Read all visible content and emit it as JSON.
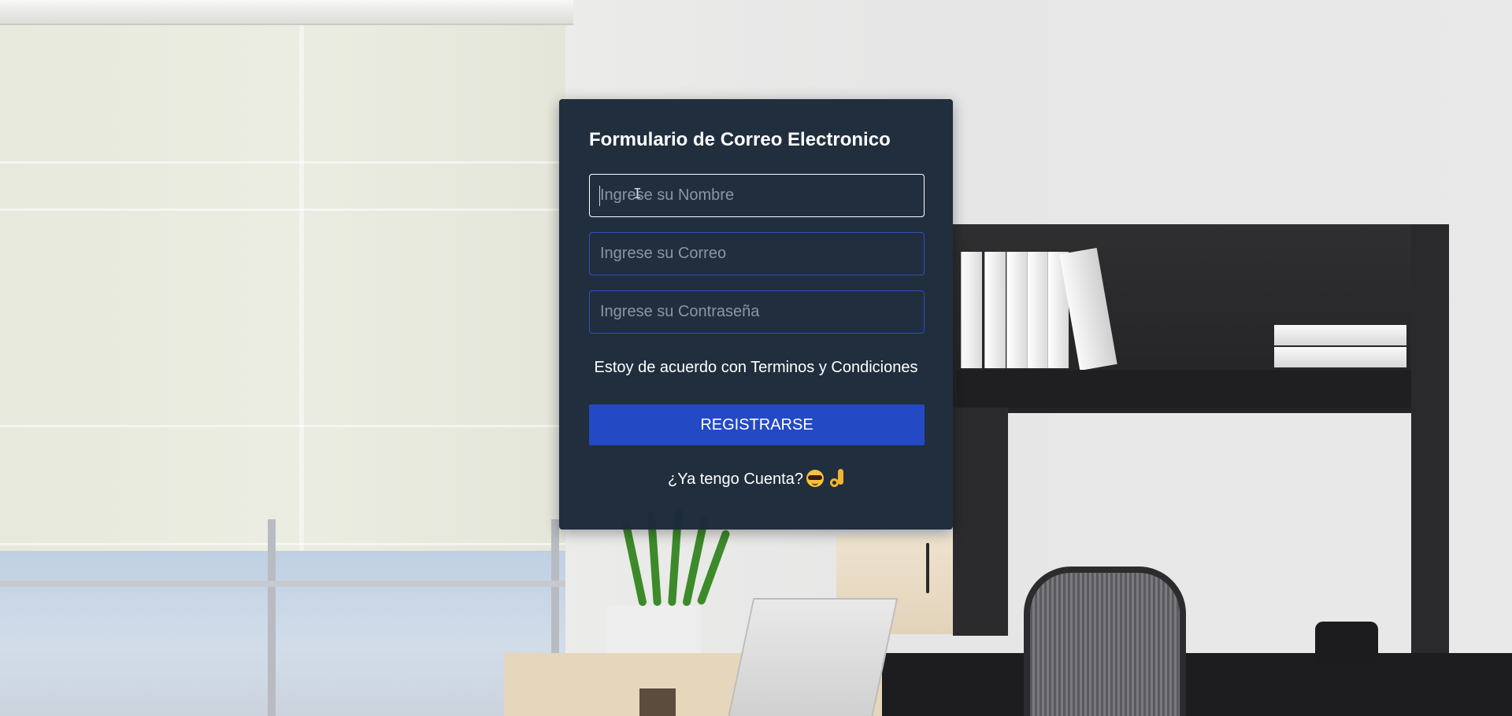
{
  "form": {
    "title": "Formulario de Correo Electronico",
    "name_placeholder": "Ingrese su Nombre",
    "email_placeholder": "Ingrese su Correo",
    "password_placeholder": "Ingrese su Contraseña",
    "name_value": "",
    "email_value": "",
    "password_value": "",
    "terms_text": "Estoy de acuerdo con Terminos y Condiciones",
    "register_label": "REGISTRARSE",
    "login_text": "¿Ya tengo Cuenta?",
    "login_icons": [
      "smiling-face-with-sunglasses-icon",
      "ok-hand-icon"
    ]
  },
  "colors": {
    "card_background": "#1d2a3a",
    "button_background": "#2449c4",
    "input_border": "#2d4fb8",
    "focused_input_border": "#ffffff",
    "text": "#ffffff",
    "placeholder": "#8b95a3"
  }
}
